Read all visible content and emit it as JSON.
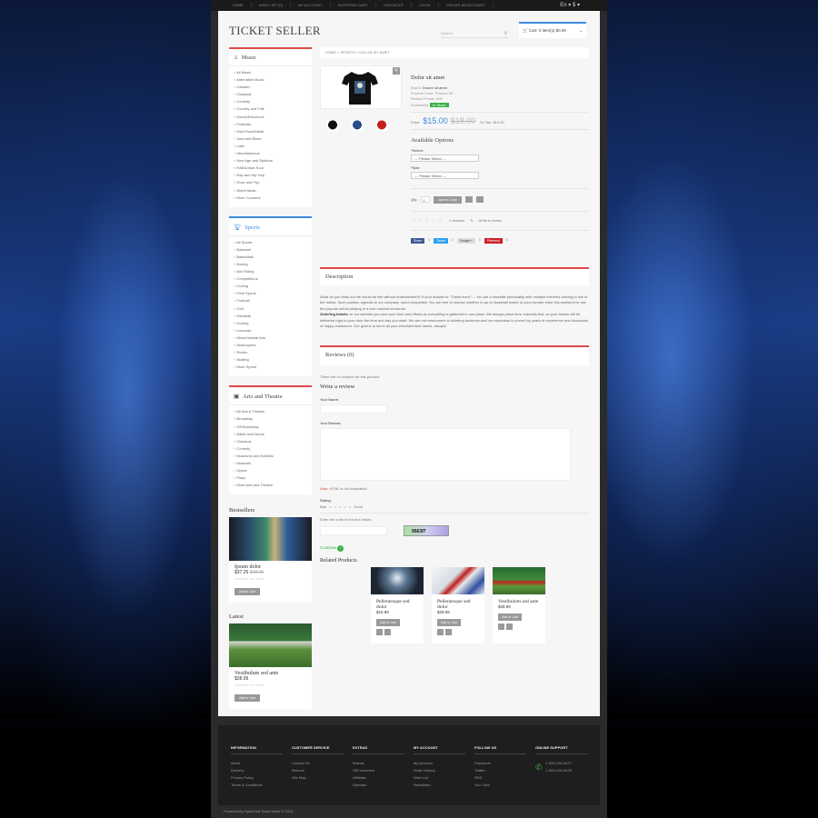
{
  "topnav": [
    "Home",
    "Wish List (0)",
    "My Account",
    "Shopping Cart",
    "Checkout",
    "Login",
    "Create an account"
  ],
  "lang": "En",
  "currency": "$",
  "logo": "TICKET SELLER",
  "search_placeholder": "Search",
  "cart_label": "Cart: 0 item(s) $0.00",
  "music": {
    "title": "Music",
    "items": [
      "All Music",
      "Alternative Music",
      "Cabaret",
      "Classical",
      "Comedy",
      "Country and Folk",
      "Dance/Electronic",
      "Festivals",
      "Hard Rock/Metal",
      "Jazz and Blues",
      "Latin",
      "Miscellaneous",
      "New Age and Spiritual",
      "R&B/Urban Soul",
      "Rap and Hip Hop",
      "Rock and Pop",
      "World Music",
      "More Concerts"
    ]
  },
  "sports": {
    "title": "Sports",
    "items": [
      "All Sports",
      "Baseball",
      "Basketball",
      "Boxing",
      "Bull Riding",
      "Competitions",
      "Curling",
      "Field Sports",
      "Football",
      "Golf",
      "Handball",
      "Hockey",
      "Lacrosse",
      "Mixed Martial Arts",
      "Motorsports",
      "Rodeo",
      "Skating",
      "More Sports"
    ]
  },
  "arts": {
    "title": "Arts and Theatre",
    "items": [
      "All Arts & Theatre",
      "Broadway",
      "Off-Broadway",
      "Ballet and Dance",
      "Classical",
      "Comedy",
      "Museums and Exhibits",
      "Musicals",
      "Opera",
      "Plays",
      "More Arts and Theatre"
    ]
  },
  "bestsellers": {
    "title": "Bestsellers",
    "name": "Ipsum dolor",
    "price": "$37.25",
    "old": "$48.45",
    "btn": "Add to Cart"
  },
  "latest": {
    "title": "Latest",
    "name": "Vestibulum sed ante",
    "price": "$28.99",
    "btn": "Add to Cart"
  },
  "breadcrumb": "Home » Sports » Dolor sit amet",
  "product": {
    "title": "Dolor sit amet",
    "brand_label": "Brand:",
    "brand": "Dolore sit amet",
    "code_label": "Product Code:",
    "code": "Product 98",
    "points_label": "Reward Points:",
    "points": "800",
    "avail_label": "Availability:",
    "avail": "In Stock",
    "price_label": "Price:",
    "price": "$15.00",
    "old": "$18.00",
    "extax": "Ex Tax: $15.00",
    "opts_title": "Available Options",
    "select_label": "*Select:",
    "select_value": "--- Please Select ---",
    "size_label": "*Size:",
    "size_value": "--- Please Select ---",
    "qty_label": "Qty:",
    "qty": "1",
    "add": "Add to Cart",
    "reviews": "0 reviews",
    "write": "Write a review",
    "share": [
      "Share",
      "Tweet",
      "Google +",
      "Pinterest"
    ],
    "share_counts": [
      "0",
      "0",
      "0",
      "0"
    ]
  },
  "description": {
    "title": "Description",
    "p1": "What do you think our life would be like without entertainment? If your answer is: \"Dread bore!\" – You are a versatile personality with multiple interests striving to live to the fullest. Such position appeals to our company 'used completely' You are free to choose whether to go on baseball match of your favorite team this weekend or see the popular actors playing in a true musical tomorrow.",
    "p2_b": "Ordering tickets",
    "p2": " on our website you save your time and efforts as everything is gathered in one place. We always place fans' interests first, so your tickets will be delivered right to your door the time and day you want. We are not newcomers in ticketing business and our reputation is proved by years of experience and thousands of happy customers. Our goal is to serve all your entertainment needs, always!"
  },
  "reviews": {
    "title": "Reviews (0)",
    "none": "There are no reviews for this product.",
    "write": "Write a review",
    "name_label": "Your Name:",
    "review_label": "Your Review:",
    "note_b": "Note:",
    "note": " HTML is not translated!",
    "rating": "Rating:",
    "bad": "Bad",
    "good": "Good",
    "captcha_label": "Enter the code in the box below:",
    "captcha": "9563f7",
    "continue": "Continue"
  },
  "related": {
    "title": "Related Products",
    "items": [
      {
        "name": "Pellentesque sed dolor",
        "price": "$15.99",
        "btn": "Add to Cart"
      },
      {
        "name": "Pellentesque sed dolor",
        "price": "$29.99",
        "btn": "Add to Cart"
      },
      {
        "name": "Vestibulum sed ante",
        "price": "$28.99",
        "btn": "Add to Cart"
      }
    ]
  },
  "footer": {
    "cols": [
      {
        "h": "INFORMATION",
        "items": [
          "About",
          "Delivery",
          "Privacy Policy",
          "Terms & Conditions"
        ]
      },
      {
        "h": "CUSTOMER SERVICE",
        "items": [
          "Contact Us",
          "Returns",
          "Site Map"
        ]
      },
      {
        "h": "EXTRAS",
        "items": [
          "Brands",
          "Gift Vouchers",
          "Affiliates",
          "Specials"
        ]
      },
      {
        "h": "MY ACCOUNT",
        "items": [
          "My Account",
          "Order History",
          "Wish List",
          "Newsletter"
        ]
      },
      {
        "h": "FOLLOW US",
        "items": [
          "Facebook",
          "Twitter",
          "RSS",
          "You Tube"
        ]
      },
      {
        "h": "ONLINE SUPPORT",
        "items": [
          "1-800-234-5677",
          "1-800-234-5678"
        ]
      }
    ],
    "copy": "Powered By OpenCart Ticket seller © 2013"
  }
}
